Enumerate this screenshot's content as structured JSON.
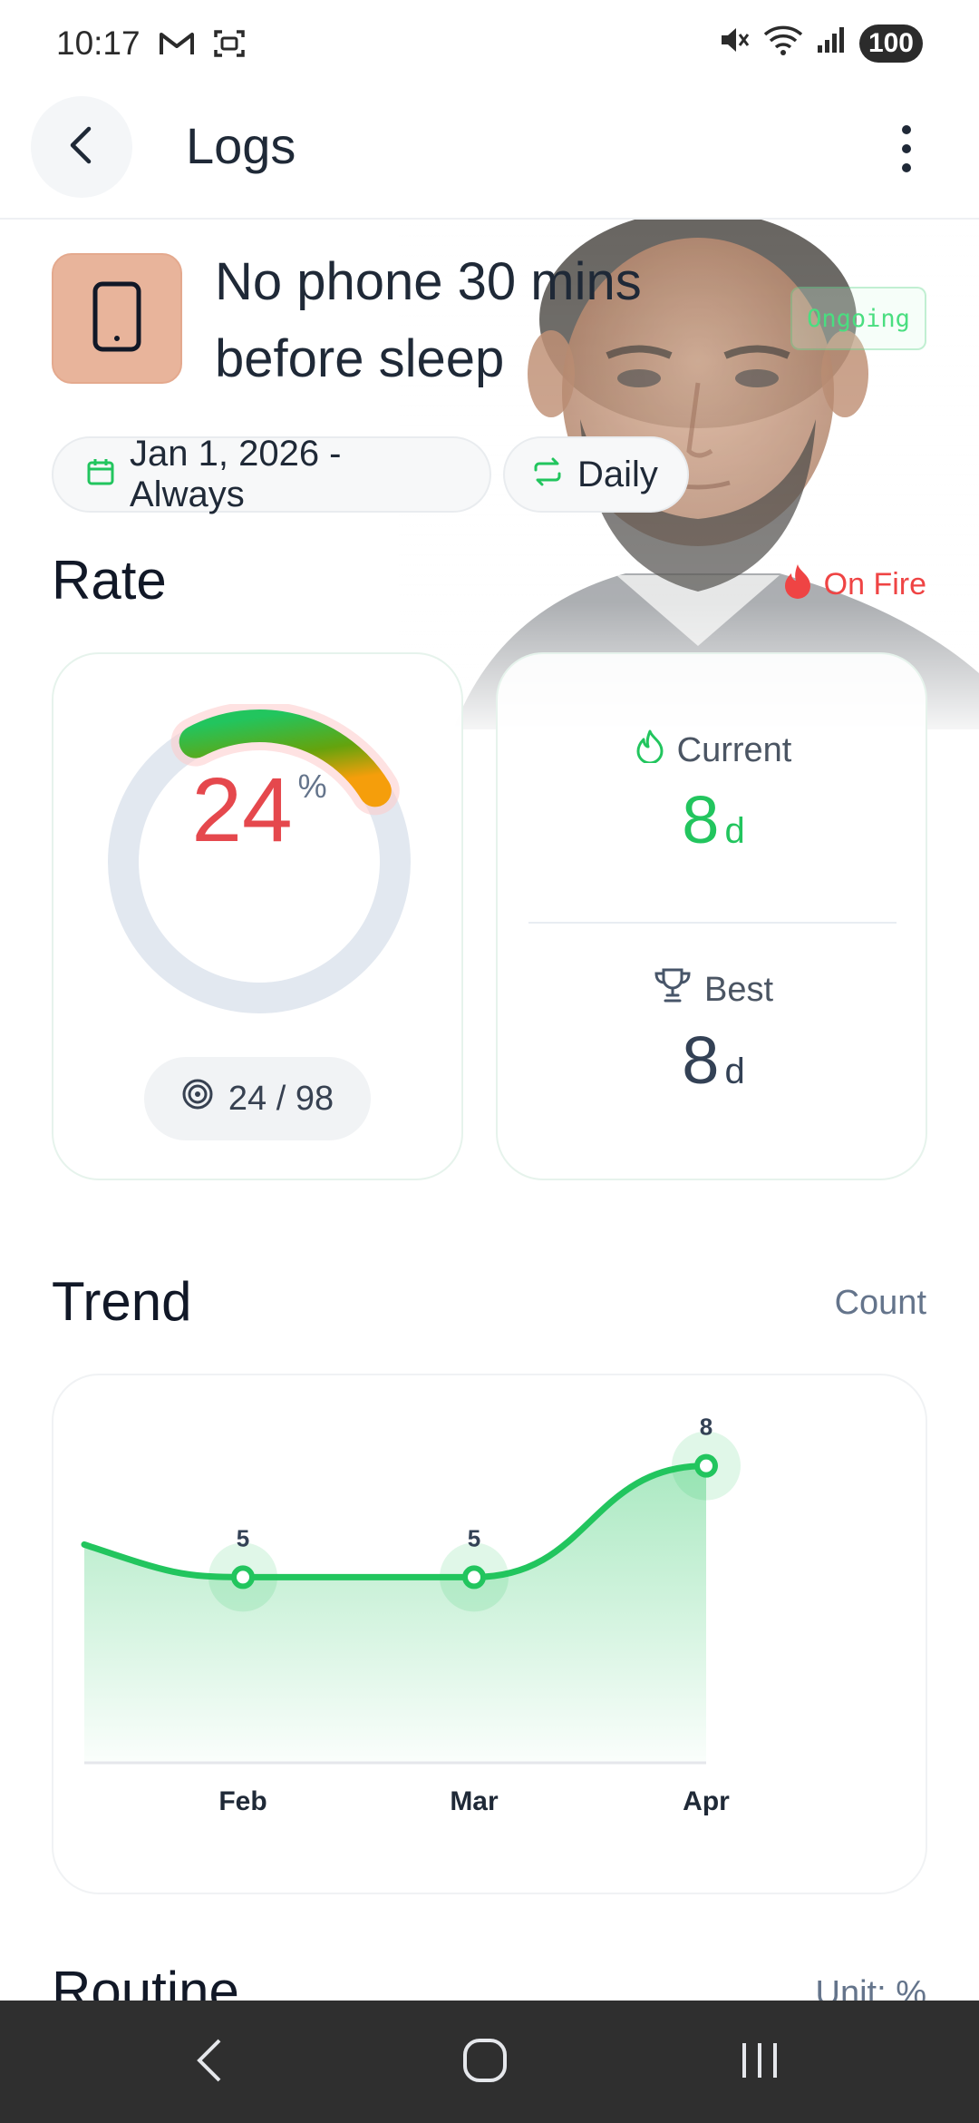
{
  "status_bar": {
    "time": "10:17",
    "battery": "100",
    "left_icons": [
      "gmail-icon",
      "screenshot-icon"
    ],
    "right_icons": [
      "mute-icon",
      "wifi-icon",
      "signal-icon"
    ]
  },
  "app_bar": {
    "title": "Logs",
    "back_icon": "back-arrow-icon",
    "menu_icon": "more-vertical-icon"
  },
  "habit": {
    "title": "No phone 30 mins before sleep",
    "icon": "phone-icon",
    "icon_bg": "#e8b49b",
    "status": "Ongoing",
    "date_range": "Jan 1, 2026 - Always",
    "frequency": "Daily"
  },
  "rate": {
    "title": "Rate",
    "badge": "On Fire",
    "percent": "24",
    "percent_symbol": "%",
    "progress_fraction": 0.24,
    "goal": "24 / 98"
  },
  "streak": {
    "current_label": "Current",
    "current_value": "8",
    "current_unit": "d",
    "best_label": "Best",
    "best_value": "8",
    "best_unit": "d"
  },
  "trend": {
    "title": "Trend",
    "mode": "Count"
  },
  "chart_data": {
    "type": "area",
    "categories": [
      "Feb",
      "Mar",
      "Apr"
    ],
    "series": [
      {
        "values": [
          5,
          5,
          8
        ]
      }
    ],
    "data_labels": [
      "5",
      "5",
      "8"
    ],
    "ylim": [
      0,
      10
    ],
    "grid": false,
    "color": "#22c55e"
  },
  "routine": {
    "title": "Routine",
    "unit": "Unit: %"
  },
  "colors": {
    "accent_green": "#22c55e",
    "rate_red": "#e5484d",
    "fire_red": "#ef4444"
  }
}
